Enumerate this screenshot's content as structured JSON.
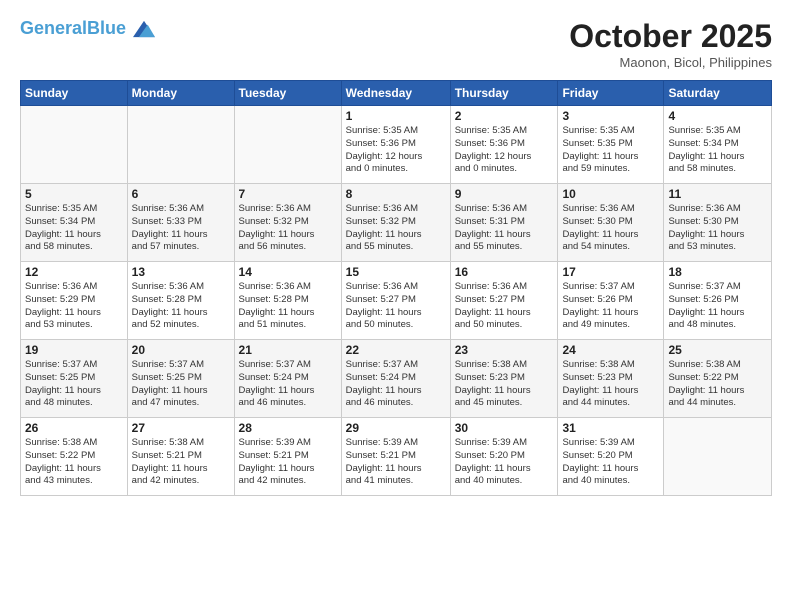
{
  "header": {
    "logo_line1": "General",
    "logo_line2": "Blue",
    "month": "October 2025",
    "location": "Maonon, Bicol, Philippines"
  },
  "weekdays": [
    "Sunday",
    "Monday",
    "Tuesday",
    "Wednesday",
    "Thursday",
    "Friday",
    "Saturday"
  ],
  "weeks": [
    [
      {
        "day": "",
        "info": ""
      },
      {
        "day": "",
        "info": ""
      },
      {
        "day": "",
        "info": ""
      },
      {
        "day": "1",
        "info": "Sunrise: 5:35 AM\nSunset: 5:36 PM\nDaylight: 12 hours\nand 0 minutes."
      },
      {
        "day": "2",
        "info": "Sunrise: 5:35 AM\nSunset: 5:36 PM\nDaylight: 12 hours\nand 0 minutes."
      },
      {
        "day": "3",
        "info": "Sunrise: 5:35 AM\nSunset: 5:35 PM\nDaylight: 11 hours\nand 59 minutes."
      },
      {
        "day": "4",
        "info": "Sunrise: 5:35 AM\nSunset: 5:34 PM\nDaylight: 11 hours\nand 58 minutes."
      }
    ],
    [
      {
        "day": "5",
        "info": "Sunrise: 5:35 AM\nSunset: 5:34 PM\nDaylight: 11 hours\nand 58 minutes."
      },
      {
        "day": "6",
        "info": "Sunrise: 5:36 AM\nSunset: 5:33 PM\nDaylight: 11 hours\nand 57 minutes."
      },
      {
        "day": "7",
        "info": "Sunrise: 5:36 AM\nSunset: 5:32 PM\nDaylight: 11 hours\nand 56 minutes."
      },
      {
        "day": "8",
        "info": "Sunrise: 5:36 AM\nSunset: 5:32 PM\nDaylight: 11 hours\nand 55 minutes."
      },
      {
        "day": "9",
        "info": "Sunrise: 5:36 AM\nSunset: 5:31 PM\nDaylight: 11 hours\nand 55 minutes."
      },
      {
        "day": "10",
        "info": "Sunrise: 5:36 AM\nSunset: 5:30 PM\nDaylight: 11 hours\nand 54 minutes."
      },
      {
        "day": "11",
        "info": "Sunrise: 5:36 AM\nSunset: 5:30 PM\nDaylight: 11 hours\nand 53 minutes."
      }
    ],
    [
      {
        "day": "12",
        "info": "Sunrise: 5:36 AM\nSunset: 5:29 PM\nDaylight: 11 hours\nand 53 minutes."
      },
      {
        "day": "13",
        "info": "Sunrise: 5:36 AM\nSunset: 5:28 PM\nDaylight: 11 hours\nand 52 minutes."
      },
      {
        "day": "14",
        "info": "Sunrise: 5:36 AM\nSunset: 5:28 PM\nDaylight: 11 hours\nand 51 minutes."
      },
      {
        "day": "15",
        "info": "Sunrise: 5:36 AM\nSunset: 5:27 PM\nDaylight: 11 hours\nand 50 minutes."
      },
      {
        "day": "16",
        "info": "Sunrise: 5:36 AM\nSunset: 5:27 PM\nDaylight: 11 hours\nand 50 minutes."
      },
      {
        "day": "17",
        "info": "Sunrise: 5:37 AM\nSunset: 5:26 PM\nDaylight: 11 hours\nand 49 minutes."
      },
      {
        "day": "18",
        "info": "Sunrise: 5:37 AM\nSunset: 5:26 PM\nDaylight: 11 hours\nand 48 minutes."
      }
    ],
    [
      {
        "day": "19",
        "info": "Sunrise: 5:37 AM\nSunset: 5:25 PM\nDaylight: 11 hours\nand 48 minutes."
      },
      {
        "day": "20",
        "info": "Sunrise: 5:37 AM\nSunset: 5:25 PM\nDaylight: 11 hours\nand 47 minutes."
      },
      {
        "day": "21",
        "info": "Sunrise: 5:37 AM\nSunset: 5:24 PM\nDaylight: 11 hours\nand 46 minutes."
      },
      {
        "day": "22",
        "info": "Sunrise: 5:37 AM\nSunset: 5:24 PM\nDaylight: 11 hours\nand 46 minutes."
      },
      {
        "day": "23",
        "info": "Sunrise: 5:38 AM\nSunset: 5:23 PM\nDaylight: 11 hours\nand 45 minutes."
      },
      {
        "day": "24",
        "info": "Sunrise: 5:38 AM\nSunset: 5:23 PM\nDaylight: 11 hours\nand 44 minutes."
      },
      {
        "day": "25",
        "info": "Sunrise: 5:38 AM\nSunset: 5:22 PM\nDaylight: 11 hours\nand 44 minutes."
      }
    ],
    [
      {
        "day": "26",
        "info": "Sunrise: 5:38 AM\nSunset: 5:22 PM\nDaylight: 11 hours\nand 43 minutes."
      },
      {
        "day": "27",
        "info": "Sunrise: 5:38 AM\nSunset: 5:21 PM\nDaylight: 11 hours\nand 42 minutes."
      },
      {
        "day": "28",
        "info": "Sunrise: 5:39 AM\nSunset: 5:21 PM\nDaylight: 11 hours\nand 42 minutes."
      },
      {
        "day": "29",
        "info": "Sunrise: 5:39 AM\nSunset: 5:21 PM\nDaylight: 11 hours\nand 41 minutes."
      },
      {
        "day": "30",
        "info": "Sunrise: 5:39 AM\nSunset: 5:20 PM\nDaylight: 11 hours\nand 40 minutes."
      },
      {
        "day": "31",
        "info": "Sunrise: 5:39 AM\nSunset: 5:20 PM\nDaylight: 11 hours\nand 40 minutes."
      },
      {
        "day": "",
        "info": ""
      }
    ]
  ]
}
